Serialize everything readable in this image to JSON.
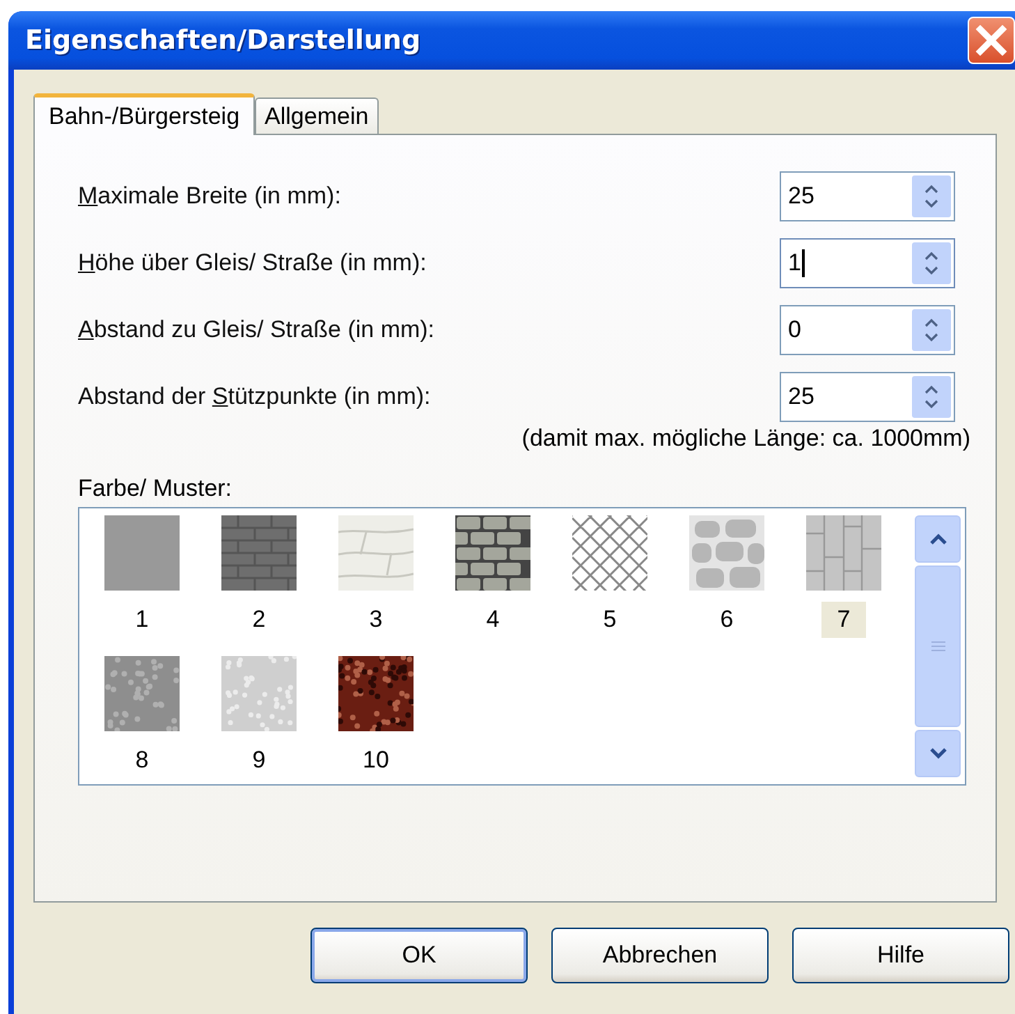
{
  "window": {
    "title": "Eigenschaften/Darstellung"
  },
  "tabs": [
    {
      "label": "Bahn-/Bürgersteig",
      "selected": true
    },
    {
      "label": "Allgemein",
      "selected": false
    }
  ],
  "fields": [
    {
      "label_key": "M",
      "label_post": "aximale Breite (in mm):",
      "value": "25",
      "focused": false
    },
    {
      "label_key": "H",
      "label_post": "öhe über Gleis/ Straße (in mm):",
      "value": "1",
      "focused": true
    },
    {
      "label_key": "A",
      "label_post": "bstand zu Gleis/ Straße (in mm):",
      "value": "0",
      "focused": false
    },
    {
      "label_pre": "Abstand der ",
      "label_key": "S",
      "label_post": "tützpunkte (in mm):",
      "value": "25",
      "focused": false
    }
  ],
  "length_note": "(damit max. mögliche Länge: ca. 1000mm)",
  "pattern_label": "Farbe/ Muster:",
  "patterns": [
    {
      "kind": "plain",
      "number": "1",
      "selected": false
    },
    {
      "kind": "brick",
      "number": "2",
      "selected": false
    },
    {
      "kind": "whitestone",
      "number": "3",
      "selected": false
    },
    {
      "kind": "masonry",
      "number": "4",
      "selected": false
    },
    {
      "kind": "mesh",
      "number": "5",
      "selected": false
    },
    {
      "kind": "cobble",
      "number": "6",
      "selected": false
    },
    {
      "kind": "tiles",
      "number": "7",
      "selected": true
    },
    {
      "kind": "granite",
      "number": "8",
      "selected": false
    },
    {
      "kind": "concrete",
      "number": "9",
      "selected": false
    },
    {
      "kind": "gravel",
      "number": "10",
      "selected": false
    }
  ],
  "buttons": [
    {
      "label": "OK",
      "default": true
    },
    {
      "label": "Abbrechen",
      "default": false
    },
    {
      "label": "Hilfe",
      "default": false
    }
  ]
}
